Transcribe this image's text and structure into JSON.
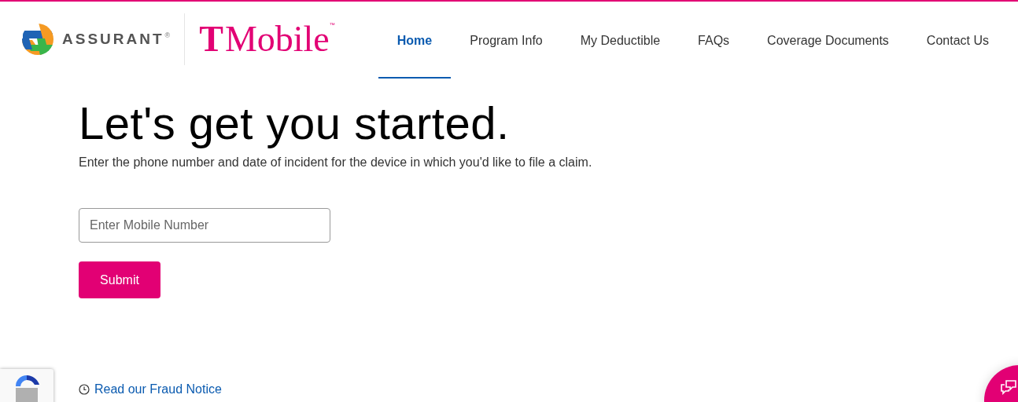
{
  "header": {
    "assurant_logo": {
      "name": "ASSURANT",
      "mark": "®"
    },
    "tmobile_logo": {
      "letter": "T",
      "name": "Mobile",
      "mark": "™"
    }
  },
  "nav": [
    {
      "label": "Home",
      "selected": true
    },
    {
      "label": "Program Info",
      "selected": false
    },
    {
      "label": "My Deductible",
      "selected": false
    },
    {
      "label": "FAQs",
      "selected": false
    },
    {
      "label": "Coverage Documents",
      "selected": false
    },
    {
      "label": "Contact Us",
      "selected": false
    }
  ],
  "heading": "Let's get you started.",
  "subtitle": "Enter the phone number and date of incident for the device in which you'd like to file a claim.",
  "mobile_field": {
    "placeholder": "Enter Mobile Number"
  },
  "submit_button": "Submit",
  "fraud_link": "Read our Fraud Notice"
}
